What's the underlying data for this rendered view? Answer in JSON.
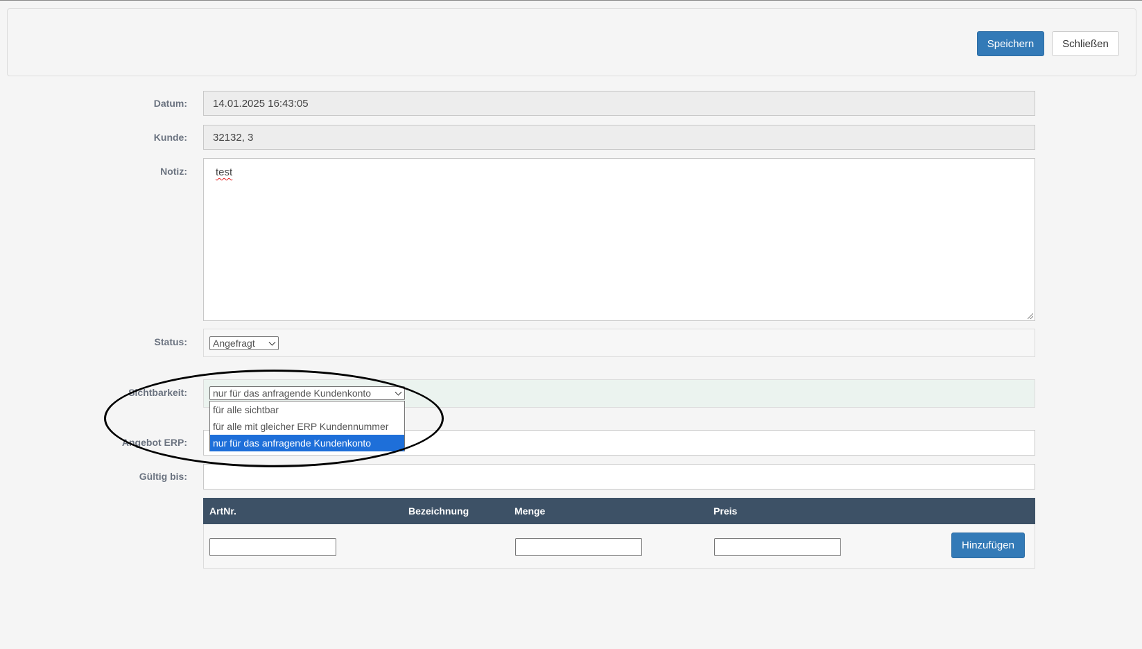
{
  "toolbar": {
    "save_label": "Speichern",
    "close_label": "Schließen"
  },
  "form": {
    "datum": {
      "label": "Datum:",
      "value": "14.01.2025 16:43:05"
    },
    "kunde": {
      "label": "Kunde:",
      "value": "32132, 3"
    },
    "notiz": {
      "label": "Notiz:",
      "value": "test"
    },
    "status": {
      "label": "Status:",
      "selected": "Angefragt"
    },
    "sichtbarkeit": {
      "label": "Sichtbarkeit:",
      "selected": "nur für das anfragende Kundenkonto",
      "options": [
        "für alle sichtbar",
        "für alle mit gleicher ERP Kundennummer",
        "nur für das anfragende Kundenkonto"
      ]
    },
    "angebot_erp": {
      "label": "Angebot ERP:",
      "value": ""
    },
    "gueltig_bis": {
      "label": "Gültig bis:",
      "value": ""
    }
  },
  "table": {
    "headers": [
      "ArtNr.",
      "Bezeichnung",
      "Menge",
      "Preis"
    ],
    "add_label": "Hinzufügen"
  },
  "colors": {
    "primary": "#337ab7",
    "table_header": "#3d5166",
    "option_selected": "#1e6fd9"
  }
}
